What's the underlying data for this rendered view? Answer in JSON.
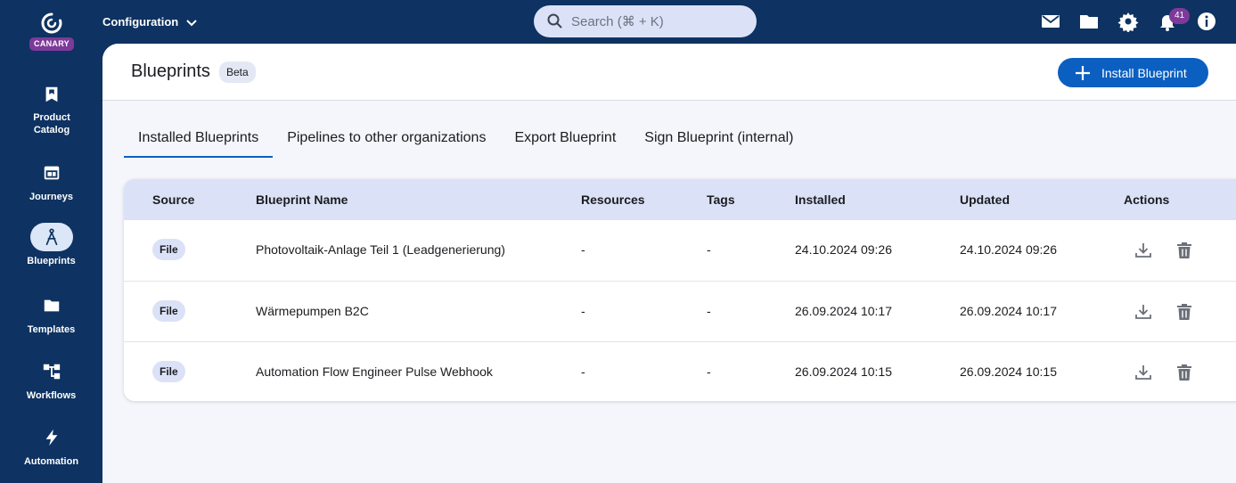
{
  "app": {
    "badge": "CANARY"
  },
  "sidebar": {
    "items": [
      {
        "label": "Product Catalog",
        "icon": "bookmark-icon",
        "active": false
      },
      {
        "label": "Journeys",
        "icon": "journey-icon",
        "active": false
      },
      {
        "label": "Blueprints",
        "icon": "compass-icon",
        "active": true
      },
      {
        "label": "Templates",
        "icon": "folder-icon",
        "active": false
      },
      {
        "label": "Workflows",
        "icon": "workflow-icon",
        "active": false
      },
      {
        "label": "Automation",
        "icon": "bolt-icon",
        "active": false
      }
    ]
  },
  "topbar": {
    "section": "Configuration",
    "search_placeholder": "Search (⌘ + K)",
    "notification_count": "41"
  },
  "page": {
    "title": "Blueprints",
    "badge": "Beta",
    "install_button": "Install Blueprint"
  },
  "tabs": [
    {
      "label": "Installed Blueprints",
      "active": true
    },
    {
      "label": "Pipelines to other organizations",
      "active": false
    },
    {
      "label": "Export Blueprint",
      "active": false
    },
    {
      "label": "Sign Blueprint (internal)",
      "active": false
    }
  ],
  "table": {
    "columns": [
      "Source",
      "Blueprint Name",
      "Resources",
      "Tags",
      "Installed",
      "Updated",
      "Actions"
    ],
    "rows": [
      {
        "source": "File",
        "name": "Photovoltaik-Anlage Teil 1 (Leadgenerierung)",
        "resources": "-",
        "tags": "-",
        "installed": "24.10.2024 09:26",
        "updated": "24.10.2024 09:26"
      },
      {
        "source": "File",
        "name": "Wärmepumpen B2C",
        "resources": "-",
        "tags": "-",
        "installed": "26.09.2024 10:17",
        "updated": "26.09.2024 10:17"
      },
      {
        "source": "File",
        "name": "Automation Flow Engineer Pulse Webhook",
        "resources": "-",
        "tags": "-",
        "installed": "26.09.2024 10:15",
        "updated": "26.09.2024 10:15"
      }
    ]
  },
  "colors": {
    "navy": "#0e3261",
    "accent": "#0b5fc1",
    "badge": "#7d3a9a",
    "header_row": "#dbe2f7"
  }
}
